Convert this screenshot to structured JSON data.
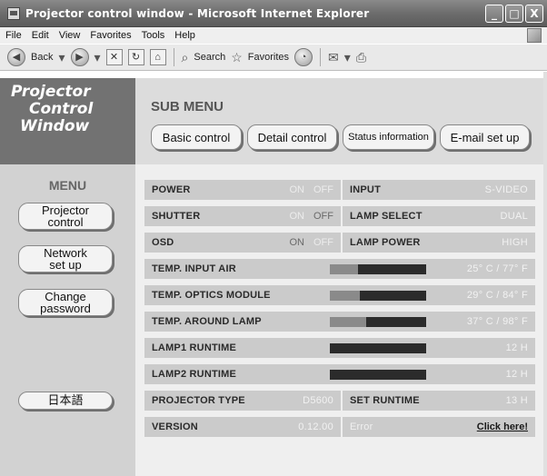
{
  "window": {
    "title": "Projector control window - Microsoft Internet Explorer",
    "minimize": "_",
    "maximize": "□",
    "close": "X"
  },
  "menubar": [
    "File",
    "Edit",
    "View",
    "Favorites",
    "Tools",
    "Help"
  ],
  "toolbar": {
    "back": "Back",
    "search": "Search",
    "favorites": "Favorites"
  },
  "logo": {
    "line1": "Projector",
    "line2": "Control",
    "line3": "Window"
  },
  "sub_menu": {
    "title": "SUB MENU",
    "buttons": [
      "Basic control",
      "Detail control",
      "Status information",
      "E-mail set up"
    ]
  },
  "left_menu": {
    "title": "MENU",
    "projector_control": [
      "Projector",
      "control"
    ],
    "network_setup": [
      "Network",
      "set up"
    ],
    "change_password": [
      "Change",
      "password"
    ],
    "language": "日本語"
  },
  "status": {
    "power": {
      "label": "POWER",
      "on": "ON",
      "off": "OFF",
      "state": "off"
    },
    "shutter": {
      "label": "SHUTTER",
      "on": "ON",
      "off": "OFF",
      "state": "off"
    },
    "osd": {
      "label": "OSD",
      "on": "ON",
      "off": "OFF",
      "state": "on"
    },
    "input": {
      "label": "INPUT",
      "value": "S-VIDEO"
    },
    "lamp_select": {
      "label": "LAMP SELECT",
      "value": "DUAL"
    },
    "lamp_power": {
      "label": "LAMP POWER",
      "value": "HIGH"
    },
    "temp_input_air": {
      "label": "TEMP. INPUT AIR",
      "value": "25° C / 77° F",
      "level": 0.29
    },
    "temp_optics": {
      "label": "TEMP. OPTICS MODULE",
      "value": "29° C / 84° F",
      "level": 0.31
    },
    "temp_lamp": {
      "label": "TEMP. AROUND LAMP",
      "value": "37° C / 98° F",
      "level": 0.38
    },
    "lamp1_runtime": {
      "label": "LAMP1 RUNTIME",
      "value": "12 H"
    },
    "lamp2_runtime": {
      "label": "LAMP2 RUNTIME",
      "value": "12 H"
    },
    "projector_type": {
      "label": "PROJECTOR TYPE",
      "value": "D5600"
    },
    "set_runtime": {
      "label": "SET RUNTIME",
      "value": "13 H"
    },
    "version": {
      "label": "VERSION",
      "value": "0.12.00"
    },
    "error": {
      "label": "Error",
      "link": "Click here!"
    }
  }
}
